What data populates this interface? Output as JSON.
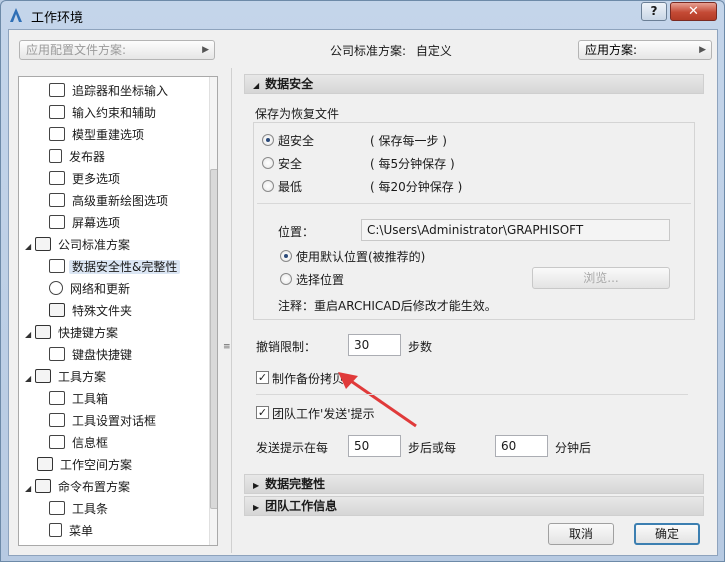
{
  "window": {
    "title": "工作环境",
    "help": "?",
    "close": "✕"
  },
  "top": {
    "profile_combo": "应用配置文件方案:",
    "company_label": "公司标准方案:",
    "company_value": "自定义",
    "apply_combo": "应用方案:"
  },
  "tree": [
    {
      "label": "追踪器和坐标输入",
      "icon": "xyz-icon"
    },
    {
      "label": "输入约束和辅助",
      "icon": "cursor-icon"
    },
    {
      "label": "模型重建选项",
      "icon": "blocks-icon"
    },
    {
      "label": "发布器",
      "icon": "publisher-icon"
    },
    {
      "label": "更多选项",
      "icon": "sliders-icon"
    },
    {
      "label": "高级重新绘图选项",
      "icon": "redraw-icon"
    },
    {
      "label": "屏幕选项",
      "icon": "screen-icon"
    },
    {
      "label": "公司标准方案",
      "icon": "folder-icon"
    },
    {
      "label": "数据安全性&完整性",
      "icon": "data-safety-icon"
    },
    {
      "label": "网络和更新",
      "icon": "globe-icon"
    },
    {
      "label": "特殊文件夹",
      "icon": "folder-icon"
    },
    {
      "label": "快捷键方案",
      "icon": "folder-icon"
    },
    {
      "label": "键盘快捷键",
      "icon": "keyboard-icon"
    },
    {
      "label": "工具方案",
      "icon": "folder-icon"
    },
    {
      "label": "工具箱",
      "icon": "toolbox-icon"
    },
    {
      "label": "工具设置对话框",
      "icon": "tool-settings-icon"
    },
    {
      "label": "信息框",
      "icon": "infobox-icon"
    },
    {
      "label": "工作空间方案",
      "icon": "folder-icon"
    },
    {
      "label": "命令布置方案",
      "icon": "folder-icon"
    },
    {
      "label": "工具条",
      "icon": "toolbar-icon"
    },
    {
      "label": "菜单",
      "icon": "menu-icon"
    }
  ],
  "sections": {
    "data_safety": "数据安全",
    "data_integrity": "数据完整性",
    "teamwork_info": "团队工作信息"
  },
  "autosave": {
    "group_title": "保存为恢复文件",
    "options": [
      {
        "label": "超安全",
        "desc": "( 保存每一步 )",
        "selected": true
      },
      {
        "label": "安全",
        "desc": "( 每5分钟保存 )",
        "selected": false
      },
      {
        "label": "最低",
        "desc": "( 每20分钟保存 )",
        "selected": false
      }
    ],
    "location_label": "位置：",
    "location_value": "C:\\Users\\Administrator\\GRAPHISOFT",
    "use_default": "使用默认位置(被推荐的)",
    "choose_location": "选择位置",
    "browse": "浏览...",
    "note": "注释：重启ARCHICAD后修改才能生效。"
  },
  "undo": {
    "label": "撤销限制：",
    "value": "30",
    "unit": "步数"
  },
  "backup": {
    "label": "制作备份拷贝",
    "checked": true
  },
  "teamwork": {
    "label": "团队工作'发送'提示",
    "checked": true,
    "prompt_label": "发送提示在每",
    "steps_value": "50",
    "steps_unit": "步后或每",
    "minutes_value": "60",
    "minutes_unit": "分钟后"
  },
  "buttons": {
    "cancel": "取消",
    "ok": "确定"
  },
  "colors": {
    "selection": "#dbe6f4",
    "default_button_border": "#3c7fb1",
    "close_button": "#c44a35",
    "annotation_arrow": "#e03a3a"
  }
}
